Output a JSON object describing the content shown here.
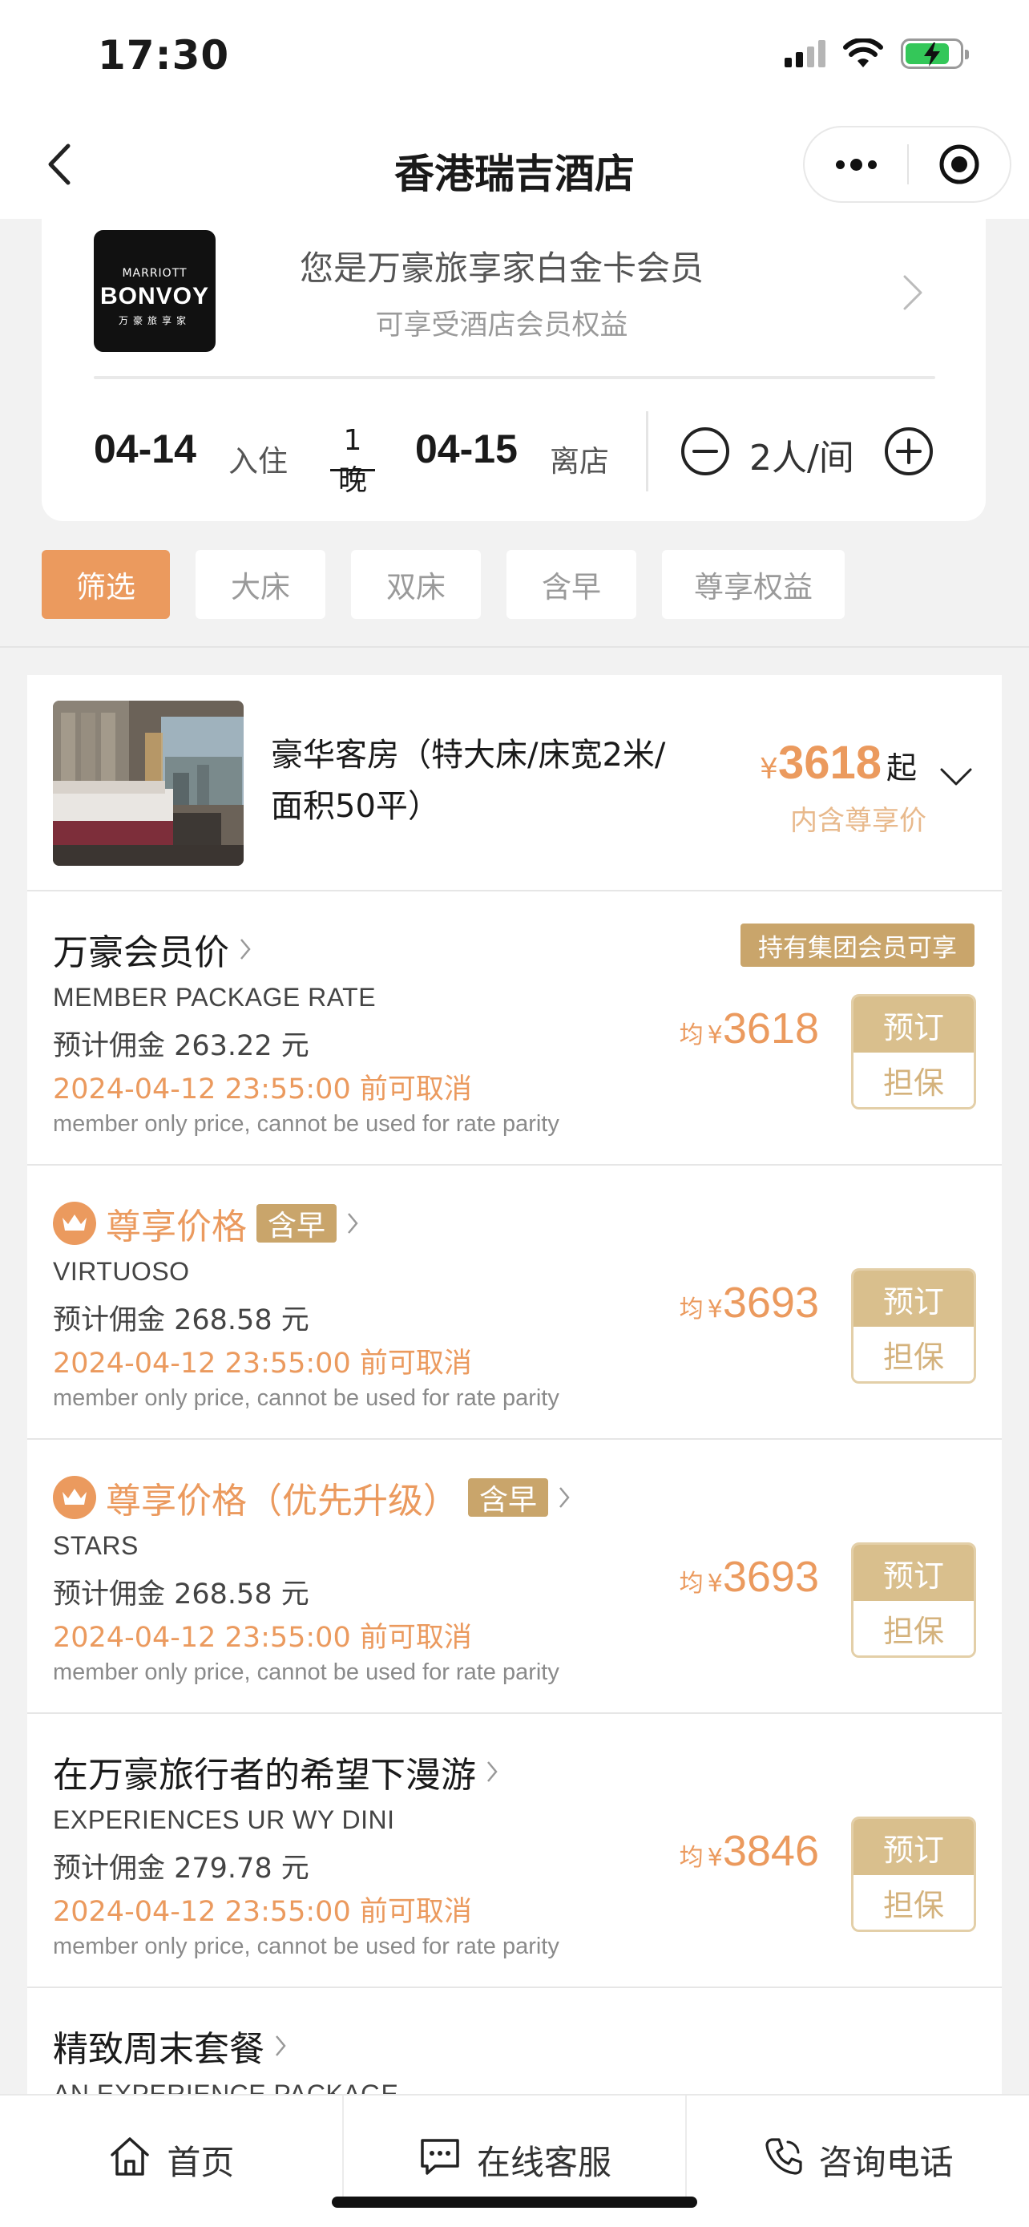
{
  "status_bar": {
    "time": "17:30"
  },
  "nav": {
    "title": "香港瑞吉酒店"
  },
  "membership": {
    "logo_line1": "MARRIOTT",
    "logo_line2": "BONVOY",
    "logo_line3": "万豪旅享家",
    "title": "您是万豪旅享家白金卡会员",
    "subtitle": "可享受酒店会员权益"
  },
  "booking": {
    "checkin_date": "04-14",
    "checkin_label": "入住",
    "nights": "1晚",
    "checkout_date": "04-15",
    "checkout_label": "离店",
    "guests": "2人/间"
  },
  "filters": [
    "筛选",
    "大床",
    "双床",
    "含早",
    "尊享权益"
  ],
  "room": {
    "name": "豪华客房（特大床/床宽2米/面积50平）",
    "currency": "¥",
    "price": "3618",
    "from_label": "起",
    "price_note": "内含尊享价"
  },
  "rates": [
    {
      "title": "万豪会员价",
      "vip": false,
      "breakfast": "",
      "member_tag": "持有集团会员可享",
      "code": "MEMBER PACKAGE RATE",
      "commission": "预计佣金 263.22 元",
      "cancel": "2024-04-12 23:55:00 前可取消",
      "note": "member only price, cannot be used for rate parity",
      "avg_label": "均",
      "currency": "¥",
      "price": "3618",
      "book_label": "预订",
      "guarantee_label": "担保"
    },
    {
      "title": "尊享价格",
      "vip": true,
      "breakfast": "含早",
      "member_tag": "",
      "code": "VIRTUOSO",
      "commission": "预计佣金 268.58 元",
      "cancel": "2024-04-12 23:55:00 前可取消",
      "note": "member only price, cannot be used for rate parity",
      "avg_label": "均",
      "currency": "¥",
      "price": "3693",
      "book_label": "预订",
      "guarantee_label": "担保"
    },
    {
      "title": "尊享价格（优先升级）",
      "vip": true,
      "breakfast": "含早",
      "member_tag": "",
      "code": "STARS",
      "commission": "预计佣金 268.58 元",
      "cancel": "2024-04-12 23:55:00 前可取消",
      "note": "member only price, cannot be used for rate parity",
      "avg_label": "均",
      "currency": "¥",
      "price": "3693",
      "book_label": "预订",
      "guarantee_label": "担保"
    },
    {
      "title": "在万豪旅行者的希望下漫游",
      "vip": false,
      "breakfast": "",
      "member_tag": "",
      "code": "EXPERIENCES UR WY DINI",
      "commission": "预计佣金 279.78 元",
      "cancel": "2024-04-12 23:55:00 前可取消",
      "note": "member only price, cannot be used for rate parity",
      "avg_label": "均",
      "currency": "¥",
      "price": "3846",
      "book_label": "预订",
      "guarantee_label": "担保"
    },
    {
      "title": "精致周末套餐",
      "code": "AN EXPERIENCE PACKAGE"
    }
  ],
  "tab_bar": {
    "home": "首页",
    "service": "在线客服",
    "phone": "咨询电话"
  },
  "colors": {
    "accent": "#eb9a5e",
    "gold": "#c9a56b",
    "battery": "#34c759"
  }
}
